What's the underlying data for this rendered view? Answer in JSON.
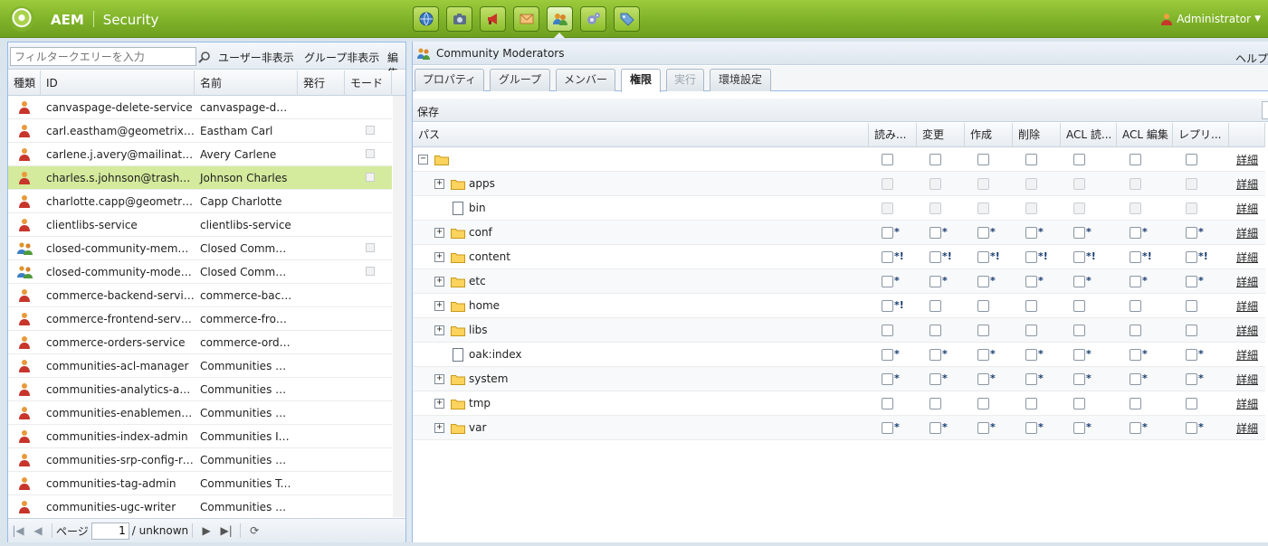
{
  "app": {
    "brand": "AEM",
    "section": "Security",
    "user": "Administrator"
  },
  "nav": {
    "icons": [
      "globe-icon",
      "camera-icon",
      "megaphone-icon",
      "envelope-icon",
      "users-icon",
      "gears-icon",
      "tag-icon"
    ],
    "active": 4
  },
  "left": {
    "filter_placeholder": "フィルタークエリーを入力",
    "hide_users": "ユーザー非表示",
    "hide_groups": "グループ非表示",
    "edit": "編集",
    "columns": [
      "種類",
      "ID",
      "名前",
      "発行",
      "モード"
    ],
    "rows": [
      {
        "type": "user",
        "id": "canvaspage-delete-service",
        "name": "canvaspage-delet...",
        "mode": false
      },
      {
        "type": "user",
        "id": "carl.eastham@geometrixx-...",
        "name": "Eastham Carl",
        "mode": true
      },
      {
        "type": "user",
        "id": "carlene.j.avery@mailinator....",
        "name": "Avery Carlene",
        "mode": true
      },
      {
        "type": "user",
        "id": "charles.s.johnson@trashym...",
        "name": "Johnson Charles",
        "mode": true,
        "selected": true
      },
      {
        "type": "user",
        "id": "charlotte.capp@geometrixx...",
        "name": "Capp Charlotte",
        "mode": false
      },
      {
        "type": "user",
        "id": "clientlibs-service",
        "name": "clientlibs-service",
        "mode": false
      },
      {
        "type": "group",
        "id": "closed-community-members",
        "name": "Closed Communi...",
        "mode": true
      },
      {
        "type": "group",
        "id": "closed-community-moderat...",
        "name": "Closed Communi...",
        "mode": true
      },
      {
        "type": "user",
        "id": "commerce-backend-service",
        "name": "commerce-backe...",
        "mode": false
      },
      {
        "type": "user",
        "id": "commerce-frontend-service",
        "name": "commerce-fronte...",
        "mode": false
      },
      {
        "type": "user",
        "id": "commerce-orders-service",
        "name": "commerce-orders...",
        "mode": false
      },
      {
        "type": "user",
        "id": "communities-acl-manager",
        "name": "Communities AC...",
        "mode": false
      },
      {
        "type": "user",
        "id": "communities-analytics-admin",
        "name": "Communities An...",
        "mode": false
      },
      {
        "type": "user",
        "id": "communities-enablement-pr...",
        "name": "Communities En...",
        "mode": false
      },
      {
        "type": "user",
        "id": "communities-index-admin",
        "name": "Communities Ind...",
        "mode": false
      },
      {
        "type": "user",
        "id": "communities-srp-config-rea...",
        "name": "Communities SR...",
        "mode": false
      },
      {
        "type": "user",
        "id": "communities-tag-admin",
        "name": "Communities Ta...",
        "mode": false
      },
      {
        "type": "user",
        "id": "communities-ugc-writer",
        "name": "Communities UG...",
        "mode": false
      }
    ],
    "pager": {
      "page_label": "ページ",
      "page": "1",
      "of": "/ unknown"
    }
  },
  "right": {
    "title": "Community Moderators",
    "help": "ヘルプ",
    "tabs": [
      {
        "label": "プロパティ",
        "state": "normal"
      },
      {
        "label": "グループ",
        "state": "normal"
      },
      {
        "label": "メンバー",
        "state": "normal"
      },
      {
        "label": "権限",
        "state": "active"
      },
      {
        "label": "実行",
        "state": "disabled"
      },
      {
        "label": "環境設定",
        "state": "normal"
      }
    ],
    "save": "保存",
    "columns": [
      "パス",
      "読み...",
      "変更",
      "作成",
      "削除",
      "ACL 読...",
      "ACL 編集",
      "レプリ..."
    ],
    "detail_label": "詳細",
    "rows": [
      {
        "name": "",
        "kind": "root-folder",
        "expander": "−",
        "marks": [
          "",
          "",
          "",
          "",
          "",
          "",
          ""
        ],
        "disabled": false
      },
      {
        "name": "apps",
        "kind": "folder",
        "expander": "+",
        "marks": [
          "",
          "",
          "",
          "",
          "",
          "",
          ""
        ],
        "disabled": true
      },
      {
        "name": "bin",
        "kind": "file",
        "expander": "",
        "marks": [
          "",
          "",
          "",
          "",
          "",
          "",
          ""
        ],
        "disabled": true
      },
      {
        "name": "conf",
        "kind": "folder",
        "expander": "+",
        "marks": [
          "*",
          "*",
          "*",
          "*",
          "*",
          "*",
          "*"
        ],
        "disabled": false
      },
      {
        "name": "content",
        "kind": "folder",
        "expander": "+",
        "marks": [
          "*!",
          "*!",
          "*!",
          "*!",
          "*!",
          "*!",
          "*!"
        ],
        "disabled": false
      },
      {
        "name": "etc",
        "kind": "folder",
        "expander": "+",
        "marks": [
          "*",
          "*",
          "*",
          "*",
          "*",
          "*",
          "*"
        ],
        "disabled": false
      },
      {
        "name": "home",
        "kind": "folder",
        "expander": "+",
        "marks": [
          "*!",
          "",
          "",
          "",
          "",
          "",
          ""
        ],
        "disabled": false
      },
      {
        "name": "libs",
        "kind": "folder",
        "expander": "+",
        "marks": [
          "",
          "",
          "",
          "",
          "",
          "",
          ""
        ],
        "disabled": false
      },
      {
        "name": "oak:index",
        "kind": "file",
        "expander": "",
        "marks": [
          "*",
          "*",
          "*",
          "*",
          "*",
          "*",
          "*"
        ],
        "disabled": false
      },
      {
        "name": "system",
        "kind": "folder",
        "expander": "+",
        "marks": [
          "*",
          "*",
          "*",
          "*",
          "*",
          "*",
          "*"
        ],
        "disabled": false
      },
      {
        "name": "tmp",
        "kind": "folder",
        "expander": "+",
        "marks": [
          "",
          "",
          "",
          "",
          "",
          "",
          ""
        ],
        "disabled": false
      },
      {
        "name": "var",
        "kind": "folder",
        "expander": "+",
        "marks": [
          "*",
          "*",
          "*",
          "*",
          "*",
          "*",
          "*"
        ],
        "disabled": false
      }
    ]
  },
  "colors": {
    "topbar": "#7fb229",
    "selected_row": "#d4ea9c",
    "panel_border": "#99bbe8"
  }
}
